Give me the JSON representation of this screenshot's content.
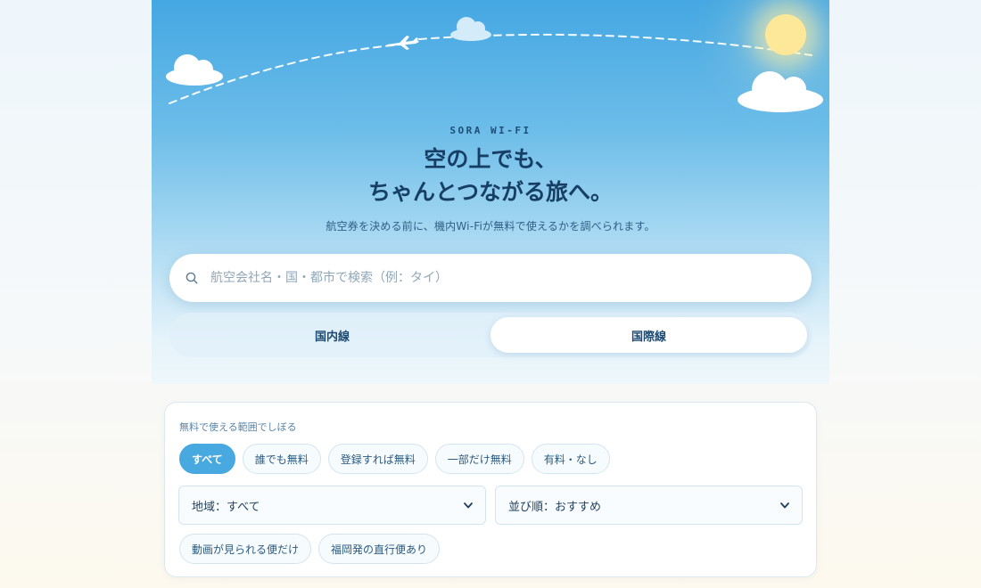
{
  "brand": "SORA WI-FI",
  "headline": {
    "line1": "空の上でも、",
    "line2": "ちゃんとつながる旅へ。"
  },
  "subtitle": "航空券を決める前に、機内Wi-Fiが無料で使えるかを調べられます。",
  "search": {
    "placeholder": "航空会社名・国・都市で検索（例：タイ）",
    "value": ""
  },
  "route_toggle": {
    "options": [
      "国内線",
      "国際線"
    ],
    "selected": "国際線"
  },
  "filters": {
    "label": "無料で使える範囲でしぼる",
    "chips": [
      "すべて",
      "誰でも無料",
      "登録すれば無料",
      "一部だけ無料",
      "有料・なし"
    ],
    "selected_chip": "すべて",
    "region_select": "地域：すべて",
    "sort_select": "並び順：おすすめ",
    "tags": [
      "動画が見られる便だけ",
      "福岡発の直行便あり"
    ]
  },
  "colors": {
    "accent": "#47a9e0",
    "heading": "#173f66",
    "sky_top": "#45a7e2"
  },
  "icons": {
    "search": "search-icon",
    "airplane": "airplane-icon",
    "sun": "sun-icon",
    "cloud": "cloud-icon",
    "select_arrow": "chevron-down-icon"
  }
}
